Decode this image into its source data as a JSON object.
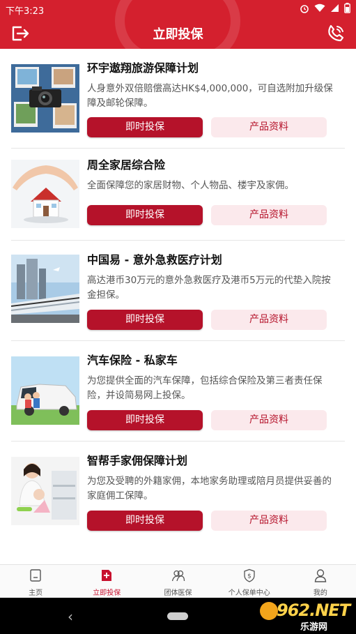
{
  "status_bar": {
    "time": "下午3:23"
  },
  "app_bar": {
    "title": "立即投保"
  },
  "products": [
    {
      "title": "环宇遨翔旅游保障计划",
      "desc": "人身意外双倍赔偿高达HK$4,000,000，可自选附加升级保障及邮轮保障。",
      "buy_label": "即时投保",
      "info_label": "产品资料"
    },
    {
      "title": "周全家居综合险",
      "desc": "全面保障您的家居财物、个人物品、楼宇及家佣。",
      "buy_label": "即时投保",
      "info_label": "产品资料"
    },
    {
      "title": "中国易 - 意外急救医疗计划",
      "desc": "高达港币30万元的意外急救医疗及港币5万元的代垫入院按金担保。",
      "buy_label": "即时投保",
      "info_label": "产品资料"
    },
    {
      "title": "汽车保险 - 私家车",
      "desc": "为您提供全面的汽车保障，包括综合保险及第三者责任保险，并设简易网上投保。",
      "buy_label": "即时投保",
      "info_label": "产品资料"
    },
    {
      "title": "智帮手家佣保障计划",
      "desc": "为您及受聘的外籍家佣，本地家务助理或陪月员提供妥善的家庭佣工保障。",
      "buy_label": "即时投保",
      "info_label": "产品资料"
    }
  ],
  "tabs": [
    {
      "label": "主页",
      "icon": "home-icon",
      "active": false
    },
    {
      "label": "立即投保",
      "icon": "insure-plus-icon",
      "active": true
    },
    {
      "label": "团体医保",
      "icon": "group-icon",
      "active": false
    },
    {
      "label": "个人保单中心",
      "icon": "shield-dollar-icon",
      "active": false
    },
    {
      "label": "我的",
      "icon": "person-icon",
      "active": false
    }
  ],
  "watermark": {
    "brand": "962.NET",
    "sub": "乐游网"
  },
  "colors": {
    "brand_red": "#d4202e",
    "button_red": "#b5122a",
    "button_pink": "#fbe9ec"
  }
}
